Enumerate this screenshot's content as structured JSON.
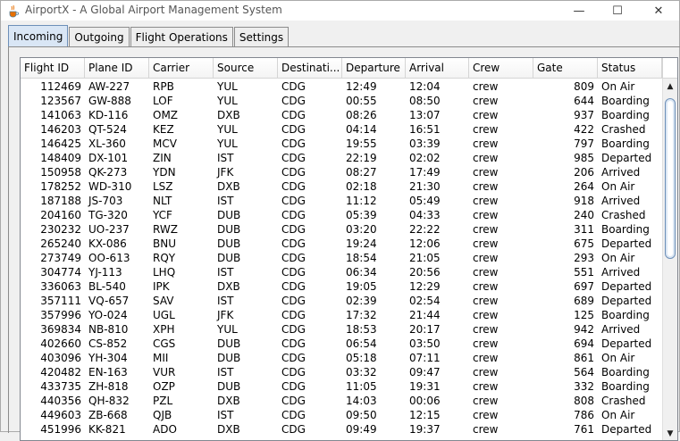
{
  "window": {
    "title": "AirportX - A Global Airport Management System",
    "minimize_glyph": "—",
    "maximize_glyph": "☐",
    "close_glyph": "✕"
  },
  "tabs": [
    {
      "label": "Incoming",
      "active": true
    },
    {
      "label": "Outgoing",
      "active": false
    },
    {
      "label": "Flight Operations",
      "active": false
    },
    {
      "label": "Settings",
      "active": false
    }
  ],
  "table": {
    "columns": [
      "Flight ID",
      "Plane ID",
      "Carrier",
      "Source",
      "Destinati...",
      "Departure",
      "Arrival",
      "Crew",
      "Gate",
      "Status"
    ],
    "rows": [
      [
        "112469",
        "AW-227",
        "RPB",
        "YUL",
        "CDG",
        "12:49",
        "12:04",
        "crew",
        "809",
        "On Air"
      ],
      [
        "123567",
        "GW-888",
        "LOF",
        "YUL",
        "CDG",
        "00:55",
        "08:50",
        "crew",
        "644",
        "Boarding"
      ],
      [
        "141063",
        "KD-116",
        "OMZ",
        "DXB",
        "CDG",
        "08:26",
        "13:07",
        "crew",
        "937",
        "Boarding"
      ],
      [
        "146203",
        "QT-524",
        "KEZ",
        "YUL",
        "CDG",
        "04:14",
        "16:51",
        "crew",
        "422",
        "Crashed"
      ],
      [
        "146425",
        "XL-360",
        "MCV",
        "YUL",
        "CDG",
        "19:55",
        "03:39",
        "crew",
        "797",
        "Boarding"
      ],
      [
        "148409",
        "DX-101",
        "ZIN",
        "IST",
        "CDG",
        "22:19",
        "02:02",
        "crew",
        "985",
        "Departed"
      ],
      [
        "150958",
        "QK-273",
        "YDN",
        "JFK",
        "CDG",
        "08:27",
        "17:49",
        "crew",
        "206",
        "Arrived"
      ],
      [
        "178252",
        "WD-310",
        "LSZ",
        "DXB",
        "CDG",
        "02:18",
        "21:30",
        "crew",
        "264",
        "On Air"
      ],
      [
        "187188",
        "JS-703",
        "NLT",
        "IST",
        "CDG",
        "11:12",
        "05:49",
        "crew",
        "918",
        "Arrived"
      ],
      [
        "204160",
        "TG-320",
        "YCF",
        "DUB",
        "CDG",
        "05:39",
        "04:33",
        "crew",
        "240",
        "Crashed"
      ],
      [
        "230232",
        "UO-237",
        "RWZ",
        "DUB",
        "CDG",
        "03:20",
        "22:22",
        "crew",
        "311",
        "Boarding"
      ],
      [
        "265240",
        "KX-086",
        "BNU",
        "DUB",
        "CDG",
        "19:24",
        "12:06",
        "crew",
        "675",
        "Departed"
      ],
      [
        "273749",
        "OO-613",
        "RQY",
        "DUB",
        "CDG",
        "18:54",
        "21:05",
        "crew",
        "293",
        "On Air"
      ],
      [
        "304774",
        "YJ-113",
        "LHQ",
        "IST",
        "CDG",
        "06:34",
        "20:56",
        "crew",
        "551",
        "Arrived"
      ],
      [
        "336063",
        "BL-540",
        "IPK",
        "DXB",
        "CDG",
        "19:05",
        "12:29",
        "crew",
        "697",
        "Departed"
      ],
      [
        "357111",
        "VQ-657",
        "SAV",
        "IST",
        "CDG",
        "02:39",
        "02:54",
        "crew",
        "689",
        "Departed"
      ],
      [
        "357996",
        "YO-024",
        "UGL",
        "JFK",
        "CDG",
        "17:32",
        "21:44",
        "crew",
        "125",
        "Boarding"
      ],
      [
        "369834",
        "NB-810",
        "XPH",
        "YUL",
        "CDG",
        "18:53",
        "20:17",
        "crew",
        "942",
        "Arrived"
      ],
      [
        "402660",
        "CS-852",
        "CGS",
        "DUB",
        "CDG",
        "06:54",
        "03:50",
        "crew",
        "694",
        "Departed"
      ],
      [
        "403096",
        "YH-304",
        "MII",
        "DUB",
        "CDG",
        "05:18",
        "07:11",
        "crew",
        "861",
        "On Air"
      ],
      [
        "420482",
        "EN-163",
        "VUR",
        "IST",
        "CDG",
        "03:32",
        "09:47",
        "crew",
        "564",
        "Boarding"
      ],
      [
        "433735",
        "ZH-818",
        "OZP",
        "DUB",
        "CDG",
        "11:05",
        "19:31",
        "crew",
        "332",
        "Boarding"
      ],
      [
        "440356",
        "QH-832",
        "PZL",
        "DXB",
        "CDG",
        "14:03",
        "00:06",
        "crew",
        "808",
        "Crashed"
      ],
      [
        "449603",
        "ZB-668",
        "QJB",
        "IST",
        "CDG",
        "09:50",
        "12:15",
        "crew",
        "786",
        "On Air"
      ],
      [
        "451996",
        "KK-821",
        "ADO",
        "DXB",
        "CDG",
        "09:49",
        "19:37",
        "crew",
        "761",
        "Departed"
      ]
    ]
  },
  "scrollbar": {
    "up_glyph": "▲",
    "down_glyph": "▼",
    "position": 0.0
  },
  "colors": {
    "active_tab": "#d9e6f5",
    "table_border": "#828790",
    "scroll_thumb_border": "#6d8fb8"
  }
}
